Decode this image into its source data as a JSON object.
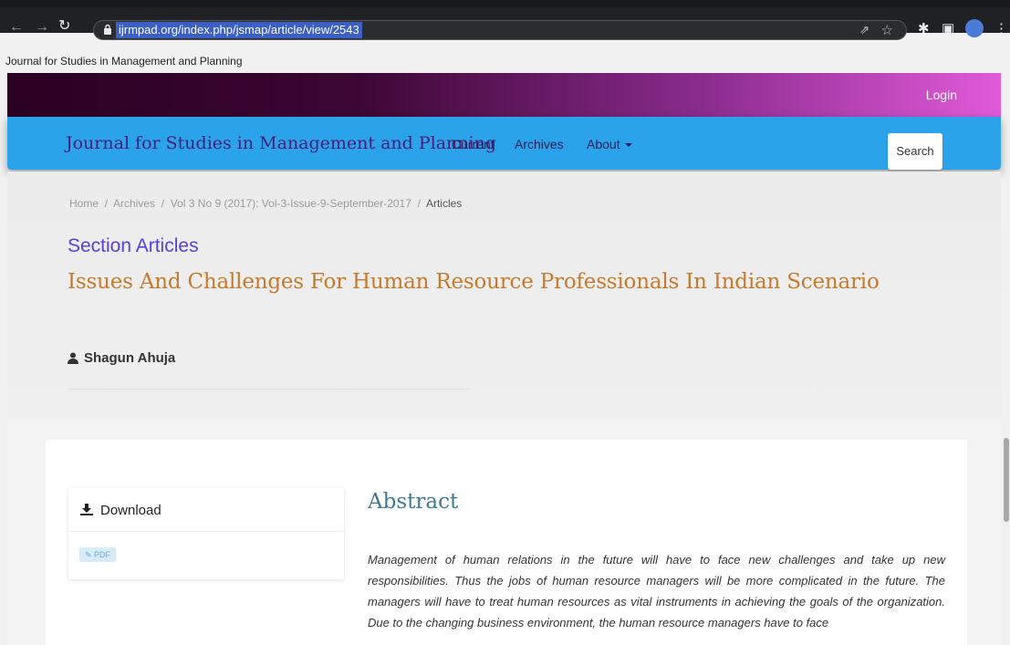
{
  "browser": {
    "url": "ijrmpad.org/index.php/jsmap/article/view/2543"
  },
  "site": {
    "name": "Journal for Studies in Management and Planning",
    "login_label": "Login"
  },
  "navbar": {
    "brand": "Journal for Studies in Management and Planning",
    "links": [
      "Current",
      "Archives",
      "About"
    ],
    "search_label": "Search"
  },
  "breadcrumb": {
    "home": "Home",
    "archives": "Archives",
    "issue": "Vol 3 No 9 (2017): Vol-3-Issue-9-September-2017",
    "current": "Articles",
    "separator": "/"
  },
  "article": {
    "section": "Section Articles",
    "title": "Issues And Challenges For Human Resource Professionals In Indian Scenario",
    "author": "Shagun Ahuja"
  },
  "download": {
    "heading": "Download",
    "pdf_label": "PDF"
  },
  "abstract": {
    "heading": "Abstract",
    "text": "Management of human relations in the future will have to face new challenges and take up new responsibilities. Thus the jobs of human resource managers will be more complicated in the future. The managers will have to treat human resources as vital instruments in achieving the goals of the organization. Due to the changing business environment, the human resource managers have to face"
  },
  "colors": {
    "navbar": "#2aa3eb",
    "section_title": "#5a3ee0",
    "article_title": "#c67a2c",
    "abstract_heading": "#3d7a94"
  }
}
